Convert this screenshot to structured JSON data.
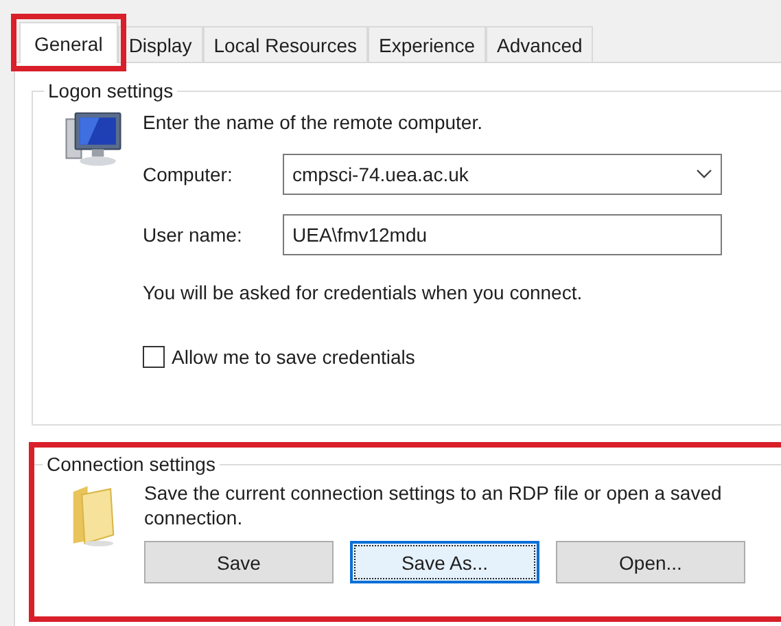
{
  "tabs": [
    {
      "label": "General",
      "selected": true,
      "highlighted": true
    },
    {
      "label": "Display",
      "selected": false,
      "highlighted": false
    },
    {
      "label": "Local Resources",
      "selected": false,
      "highlighted": false
    },
    {
      "label": "Experience",
      "selected": false,
      "highlighted": false
    },
    {
      "label": "Advanced",
      "selected": false,
      "highlighted": false
    }
  ],
  "logon_settings": {
    "title": "Logon settings",
    "instruction": "Enter the name of the remote computer.",
    "fields": [
      {
        "kind": "combo",
        "label": "Computer:",
        "value": "cmpsci-74.uea.ac.uk"
      },
      {
        "kind": "text",
        "label": "User name:",
        "value": "UEA\\fmv12mdu"
      }
    ],
    "note": "You will be asked for credentials when you connect.",
    "checkbox": {
      "label": "Allow me to save credentials",
      "checked": false
    }
  },
  "connection_settings": {
    "title": "Connection settings",
    "highlighted": true,
    "description": "Save the current connection settings to an RDP file or open a saved connection.",
    "buttons": [
      {
        "label": "Save",
        "focused": false
      },
      {
        "label": "Save As...",
        "focused": true
      },
      {
        "label": "Open...",
        "focused": false
      }
    ]
  }
}
